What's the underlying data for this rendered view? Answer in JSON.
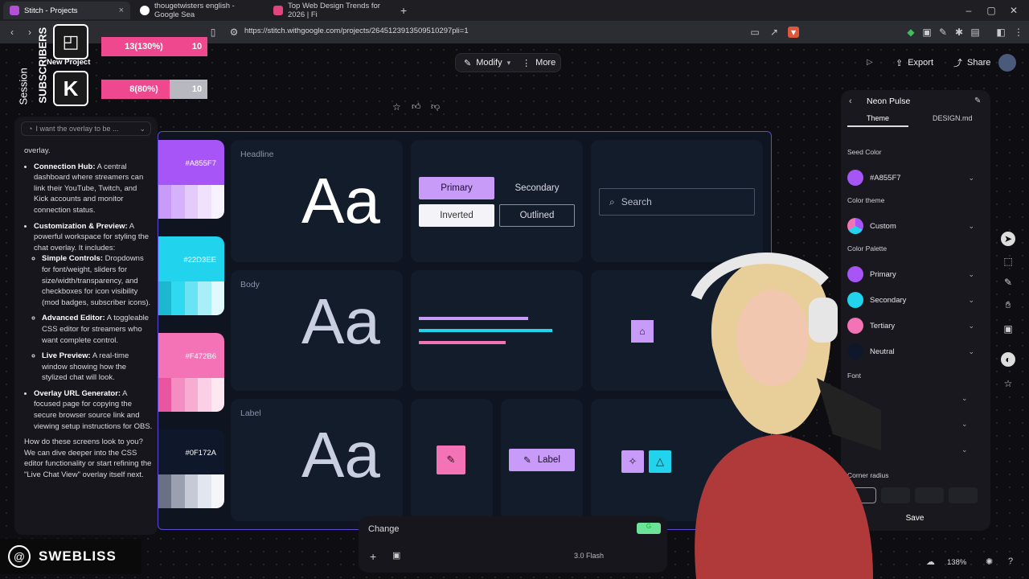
{
  "browser": {
    "tabs": [
      {
        "title": "Stitch - Projects",
        "active": true,
        "close": "×"
      },
      {
        "title": "thougetwisters english - Google Sea"
      },
      {
        "title": "Top Web Design Trends for 2026 | Fi"
      }
    ],
    "new_tab": "+",
    "url": "https://stitch.withgoogle.com/projects/2645123913509510297pli=1",
    "icons": [
      "back-icon",
      "forward-icon",
      "bookmark-icon",
      "site-settings-icon",
      "cast-icon",
      "share-page-icon",
      "brave-shield-icon",
      "extension-icons",
      "sidebar-icon",
      "profile-icon",
      "menu-icon"
    ]
  },
  "toolbar": {
    "modify_label": "Modify",
    "more_label": "More",
    "export_label": "Export",
    "share_label": "Share"
  },
  "new_project_label": "New Project",
  "chat": {
    "prompt_placeholder": "I want the overlay to be ...",
    "intro": "overlay.",
    "items": [
      {
        "title": "Connection Hub:",
        "text": " A central dashboard where streamers can link their YouTube, Twitch, and Kick accounts and monitor connection status."
      },
      {
        "title": "Customization & Preview:",
        "text": " A powerful workspace for styling the chat overlay. It includes:"
      }
    ],
    "subitems": [
      {
        "title": "Simple Controls:",
        "text": " Dropdowns for font/weight, sliders for size/width/transparency, and checkboxes for icon visibility (mod badges, subscriber icons)."
      },
      {
        "title": "Advanced Editor:",
        "text": " A toggleable CSS editor for streamers who want complete control."
      },
      {
        "title": "Live Preview:",
        "text": " A real-time window showing how the stylized chat will look."
      }
    ],
    "item3": {
      "title": "Overlay URL Generator:",
      "text": " A focused page for copying the secure browser source link and viewing setup instructions for OBS."
    },
    "outro": "How do these screens look to you? We can dive deeper into the CSS editor functionality or start refining the \"Live Chat View\" overlay itself next."
  },
  "design_system": {
    "swatches": [
      {
        "hex": "#A855F7",
        "color": "#A855F7"
      },
      {
        "hex": "#22D3EE",
        "color": "#22D3EE"
      },
      {
        "hex": "#F472B6",
        "color": "#F472B6"
      },
      {
        "hex": "#0F172A",
        "color": "#0F172A"
      }
    ],
    "typography": [
      {
        "label": "Headline",
        "sample": "Aa"
      },
      {
        "label": "Body",
        "sample": "Aa"
      },
      {
        "label": "Label",
        "sample": "Aa"
      }
    ],
    "buttons": {
      "primary": "Primary",
      "secondary": "Secondary",
      "inverted": "Inverted",
      "outlined": "Outlined"
    },
    "search_placeholder": "Search",
    "label_button": "Label"
  },
  "feedback_icons": [
    "star-icon",
    "thumbs-up-icon",
    "thumbs-down-icon"
  ],
  "theme_panel": {
    "title": "Neon Pulse",
    "tabs": {
      "theme": "Theme",
      "design_md": "DESIGN.md"
    },
    "seed_color_heading": "Seed Color",
    "seed_color": "#A855F7",
    "color_theme_heading": "Color theme",
    "color_theme_value": "Custom",
    "palette_heading": "Color Palette",
    "palette": [
      {
        "name": "Primary",
        "color": "#A855F7"
      },
      {
        "name": "Secondary",
        "color": "#22D3EE"
      },
      {
        "name": "Tertiary",
        "color": "#F472B6"
      },
      {
        "name": "Neutral",
        "color": "#0F172A"
      }
    ],
    "font_heading": "Font",
    "corner_heading": "Corner radius",
    "save_label": "Save"
  },
  "composer": {
    "placeholder": "Change",
    "model": "3.0 Flash"
  },
  "zoom": "138%",
  "overlay": {
    "twitch_label": "Session",
    "subscribers_label": "SUBSCRIBERS",
    "bar1": {
      "text": "13(130%)",
      "goal": "10"
    },
    "bar2": {
      "text": "8(80%)",
      "goal": "10"
    },
    "bar1_progress": 1.0,
    "bar2_progress": 0.8,
    "streamer_name": "SWEBLISS"
  }
}
